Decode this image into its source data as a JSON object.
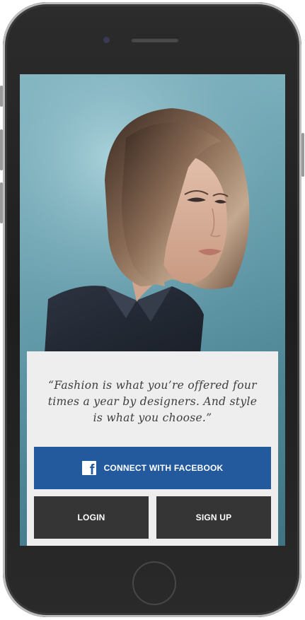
{
  "screen": {
    "quote": "“Fashion is what you’re offered four\ntimes a year by designers. And style\nis what you choose.”",
    "facebook_button": {
      "label": "CONNECT WITH FACEBOOK",
      "icon": "facebook-icon",
      "color": "#235a9e"
    },
    "login_button": {
      "label": "LOGIN"
    },
    "signup_button": {
      "label": "SIGN UP"
    },
    "dark_button_color": "#353535",
    "card_background": "#efeeee"
  }
}
